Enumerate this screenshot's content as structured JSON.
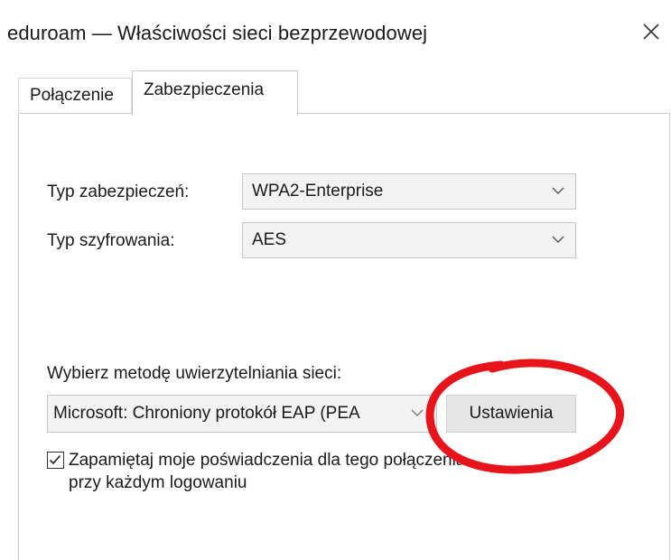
{
  "window": {
    "title": "eduroam — Właściwości sieci bezprzewodowej",
    "close_icon": "close-icon"
  },
  "tabs": [
    {
      "label": "Połączenie",
      "active": false
    },
    {
      "label": "Zabezpieczenia",
      "active": true
    }
  ],
  "security": {
    "type_label": "Typ zabezpieczeń:",
    "type_value": "WPA2-Enterprise",
    "encryption_label": "Typ szyfrowania:",
    "encryption_value": "AES"
  },
  "auth": {
    "method_label": "Wybierz metodę uwierzytelniania sieci:",
    "method_value": "Microsoft: Chroniony protokół EAP (PEA",
    "settings_button": "Ustawienia"
  },
  "remember": {
    "checked": true,
    "label_line1": "Zapamiętaj moje poświadczenia dla tego połączenia",
    "label_line2": "przy każdym logowaniu"
  },
  "colors": {
    "highlight_ellipse": "#e8141b"
  }
}
